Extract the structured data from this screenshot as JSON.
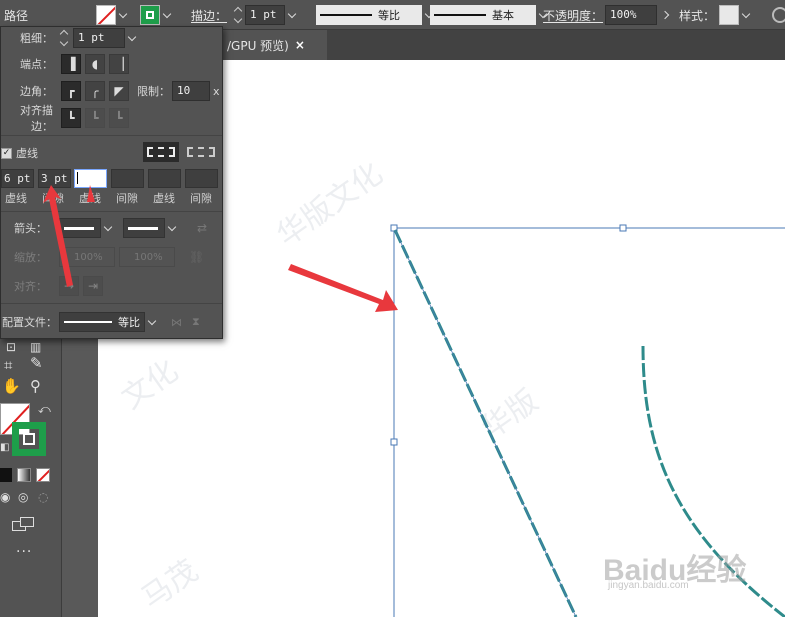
{
  "control_bar": {
    "object_type": "路径",
    "stroke_label": "描边：",
    "stroke_weight": "1 pt",
    "variable_width_label": "等比",
    "brush_label": "基本",
    "opacity_label": "不透明度：",
    "opacity_value": "100%",
    "style_label": "样式："
  },
  "document_tab": {
    "title": "/GPU 预览)",
    "close": "×"
  },
  "stroke_panel": {
    "weight_label": "粗细：",
    "weight_value": "1 pt",
    "cap_label": "端点：",
    "corner_label": "边角：",
    "limit_label": "限制：",
    "limit_value": "10",
    "limit_unit": "x",
    "align_label": "对齐描边：",
    "dashed_label": "虚线",
    "dashed_checked": true,
    "dash_values": [
      "6 pt",
      "3 pt",
      "",
      "",
      "",
      ""
    ],
    "dash_labels": [
      "虚线",
      "间隙",
      "虚线",
      "间隙",
      "虚线",
      "间隙"
    ],
    "arrowheads_label": "箭头：",
    "scale_label": "缩放：",
    "scale_start": "100%",
    "scale_end": "100%",
    "align_arrow_label": "对齐：",
    "profile_label": "配置文件：",
    "profile_value": "等比"
  },
  "canvas": {
    "path_color": "#2e8b8b",
    "selection_color": "#4a78b5",
    "watermark_brand": "Baidu经验",
    "watermark_url": "jingyan.baidu.com"
  },
  "colors": {
    "ui_bg": "#535353",
    "annotation_red": "#e8383d",
    "stroke_swatch_green": "#1e9e4a"
  }
}
